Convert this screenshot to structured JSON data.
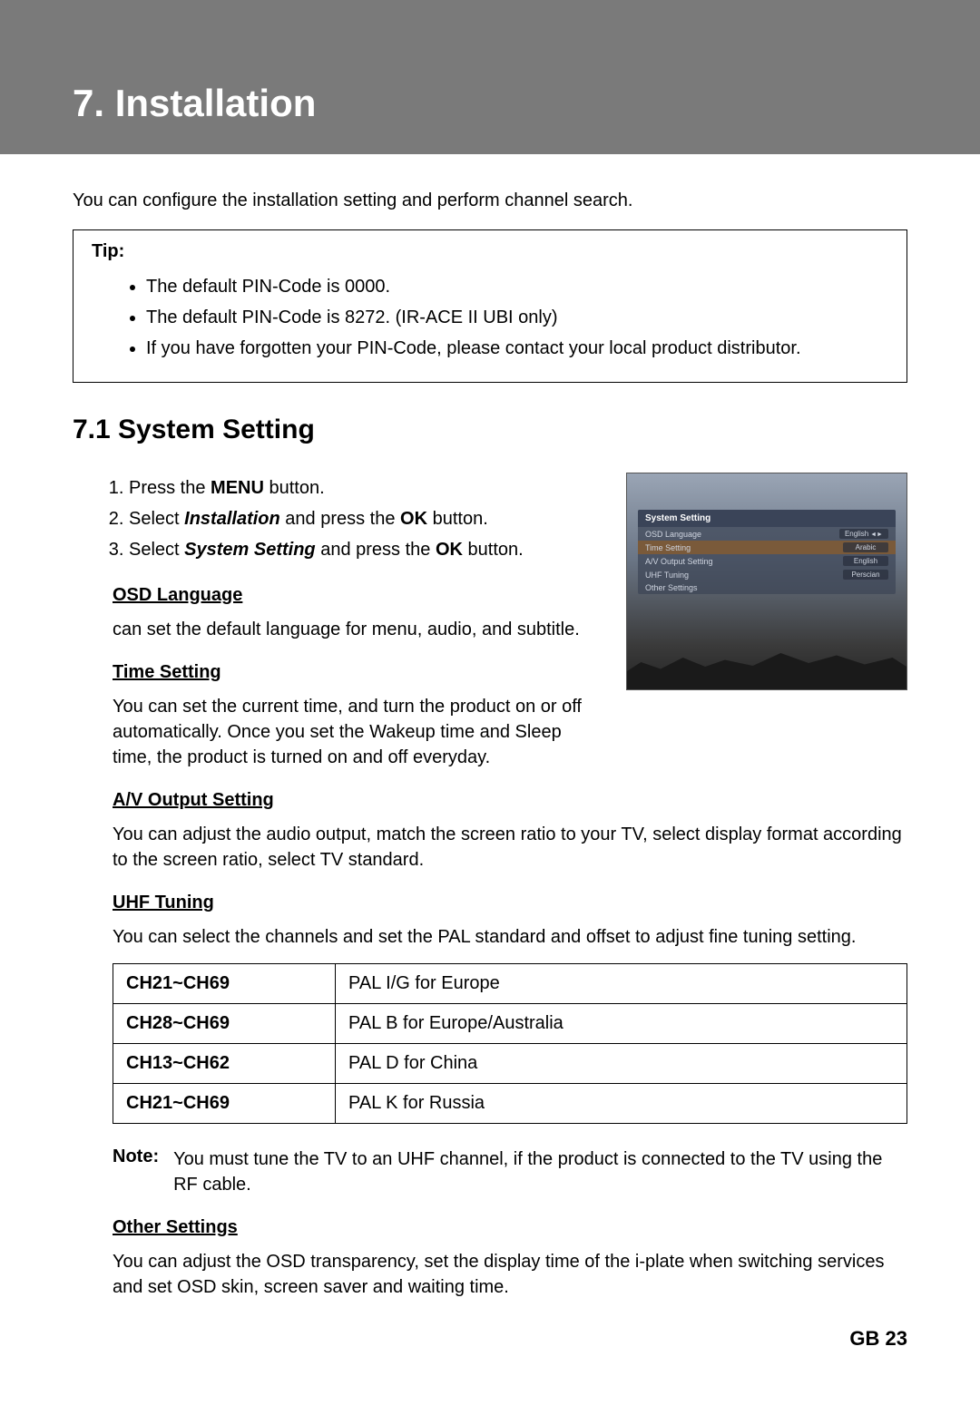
{
  "header": {
    "title": "7. Installation"
  },
  "intro": "You can configure the installation setting and perform channel search.",
  "tip": {
    "label": "Tip:",
    "items": [
      "The default PIN-Code is 0000.",
      "The default PIN-Code is 8272. (IR-ACE II UBI only)",
      "If you have forgotten your PIN-Code, please contact your local product distributor."
    ]
  },
  "section": {
    "heading": "7.1 System Setting",
    "steps": {
      "s1_pre": "Press the ",
      "s1_bold": "MENU",
      "s1_post": " button.",
      "s2_pre": "Select ",
      "s2_bolditalic": "Installation",
      "s2_mid": " and press the ",
      "s2_bold": "OK",
      "s2_post": " button.",
      "s3_pre": "Select ",
      "s3_bolditalic": "System Setting",
      "s3_mid": " and press the ",
      "s3_bold": "OK",
      "s3_post": " button."
    },
    "osd": {
      "heading": "OSD Language",
      "text": "can set the default language for menu, audio, and subtitle."
    },
    "time": {
      "heading": "Time Setting",
      "text": "You can set the current time, and turn the product on or off automatically. Once you set the Wakeup time and Sleep time, the product is turned on and off everyday."
    },
    "av": {
      "heading": "A/V Output Setting",
      "text": "You can adjust the audio output, match the screen ratio to your TV, select display format according to the screen ratio, select TV standard."
    },
    "uhf": {
      "heading": "UHF Tuning",
      "text": "You can select the channels and set the PAL standard and offset to adjust fine tuning setting."
    },
    "table": [
      {
        "ch": "CH21~CH69",
        "std": "PAL I/G for Europe"
      },
      {
        "ch": "CH28~CH69",
        "std": "PAL B for Europe/Australia"
      },
      {
        "ch": "CH13~CH62",
        "std": "PAL D for China"
      },
      {
        "ch": "CH21~CH69",
        "std": "PAL K for Russia"
      }
    ],
    "note": {
      "label": "Note:",
      "text": "You must tune the TV to an UHF channel, if the product is connected to the TV using the RF cable."
    },
    "other": {
      "heading": "Other Settings",
      "text": "You can adjust the OSD transparency, set the display time of the i-plate when switching services and set OSD skin, screen saver and waiting time."
    }
  },
  "screenshot": {
    "title": "System Setting",
    "rows": [
      {
        "label": "OSD Language",
        "value": "English"
      },
      {
        "label": "Time Setting",
        "value": "Arabic"
      },
      {
        "label": "A/V Output Setting",
        "value": "English"
      },
      {
        "label": "UHF Tuning",
        "value": "Perscian"
      },
      {
        "label": "Other Settings",
        "value": ""
      }
    ]
  },
  "footer": {
    "page": "GB 23"
  }
}
